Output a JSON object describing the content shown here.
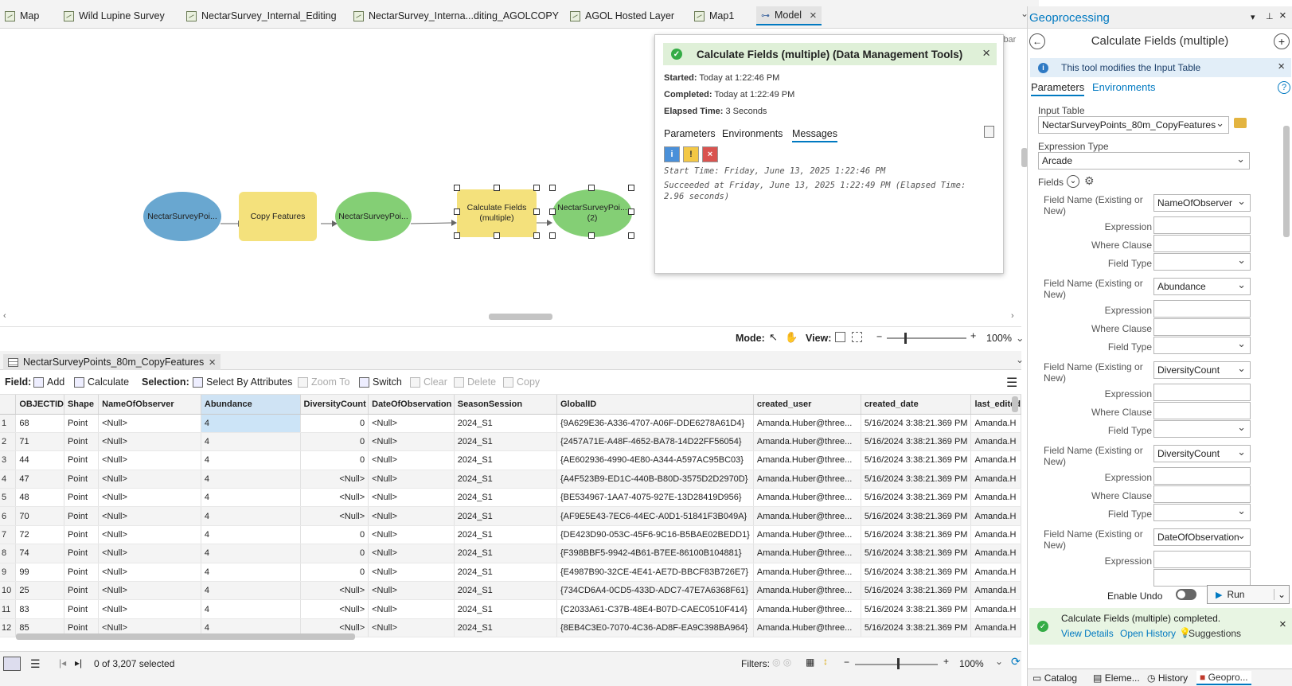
{
  "tabs": [
    {
      "label": "Map"
    },
    {
      "label": "Wild Lupine Survey"
    },
    {
      "label": "NectarSurvey_Internal_Editing"
    },
    {
      "label": "NectarSurvey_Interna...diting_AGOLCOPY"
    },
    {
      "label": "AGOL Hosted Layer"
    },
    {
      "label": "Map1"
    },
    {
      "label": "Model"
    }
  ],
  "model": {
    "nodes": [
      {
        "label": "NectarSurveyPoi...",
        "color": "#69a7d0"
      },
      {
        "label": "Copy Features",
        "color": "#f4e17c"
      },
      {
        "label": "NectarSurveyPoi...",
        "color": "#84cf75"
      },
      {
        "label": "Calculate Fields (multiple)",
        "color": "#f4e17c"
      },
      {
        "label": "NectarSurveyPoi... (2)",
        "color": "#84cf75"
      }
    ],
    "hidden_text": "lbar",
    "mode_label": "Mode:",
    "view_label": "View:",
    "zoom": "100%"
  },
  "popup": {
    "title": "Calculate Fields (multiple) (Data Management Tools)",
    "started_label": "Started:",
    "started_value": "Today at 1:22:46 PM",
    "completed_label": "Completed:",
    "completed_value": "Today at 1:22:49 PM",
    "elapsed_label": "Elapsed Time:",
    "elapsed_value": "3 Seconds",
    "tabs": [
      "Parameters",
      "Environments",
      "Messages"
    ],
    "msg1": "Start Time: Friday, June 13, 2025 1:22:46 PM",
    "msg2": "Succeeded at Friday, June 13, 2025 1:22:49 PM (Elapsed Time:",
    "msg3": "2.96 seconds)"
  },
  "table": {
    "tab_label": "NectarSurveyPoints_80m_CopyFeatures",
    "toolbar": {
      "field_label": "Field:",
      "add": "Add",
      "calculate": "Calculate",
      "selection_label": "Selection:",
      "select_by_attr": "Select By Attributes",
      "zoom_to": "Zoom To",
      "switch": "Switch",
      "clear": "Clear",
      "delete": "Delete",
      "copy": "Copy"
    },
    "columns": [
      "OBJECTID",
      "Shape",
      "NameOfObserver",
      "Abundance",
      "DiversityCount",
      "DateOfObservation",
      "SeasonSession",
      "GlobalID",
      "created_user",
      "created_date",
      "last_edited"
    ],
    "rows": [
      [
        "1",
        "68",
        "Point",
        "<Null>",
        "4",
        "0",
        "<Null>",
        "2024_S1",
        "{9A629E36-A336-4707-A06F-DDE6278A61D4}",
        "Amanda.Huber@three...",
        "5/16/2024 3:38:21.369 PM",
        "Amanda.H"
      ],
      [
        "2",
        "71",
        "Point",
        "<Null>",
        "4",
        "0",
        "<Null>",
        "2024_S1",
        "{2457A71E-A48F-4652-BA78-14D22FF56054}",
        "Amanda.Huber@three...",
        "5/16/2024 3:38:21.369 PM",
        "Amanda.H"
      ],
      [
        "3",
        "44",
        "Point",
        "<Null>",
        "4",
        "0",
        "<Null>",
        "2024_S1",
        "{AE602936-4990-4E80-A344-A597AC95BC03}",
        "Amanda.Huber@three...",
        "5/16/2024 3:38:21.369 PM",
        "Amanda.H"
      ],
      [
        "4",
        "47",
        "Point",
        "<Null>",
        "4",
        "<Null>",
        "<Null>",
        "2024_S1",
        "{A4F523B9-ED1C-440B-B80D-3575D2D2970D}",
        "Amanda.Huber@three...",
        "5/16/2024 3:38:21.369 PM",
        "Amanda.H"
      ],
      [
        "5",
        "48",
        "Point",
        "<Null>",
        "4",
        "<Null>",
        "<Null>",
        "2024_S1",
        "{BE534967-1AA7-4075-927E-13D28419D956}",
        "Amanda.Huber@three...",
        "5/16/2024 3:38:21.369 PM",
        "Amanda.H"
      ],
      [
        "6",
        "70",
        "Point",
        "<Null>",
        "4",
        "<Null>",
        "<Null>",
        "2024_S1",
        "{AF9E5E43-7EC6-44EC-A0D1-51841F3B049A}",
        "Amanda.Huber@three...",
        "5/16/2024 3:38:21.369 PM",
        "Amanda.H"
      ],
      [
        "7",
        "72",
        "Point",
        "<Null>",
        "4",
        "0",
        "<Null>",
        "2024_S1",
        "{DE423D90-053C-45F6-9C16-B5BAE02BEDD1}",
        "Amanda.Huber@three...",
        "5/16/2024 3:38:21.369 PM",
        "Amanda.H"
      ],
      [
        "8",
        "74",
        "Point",
        "<Null>",
        "4",
        "0",
        "<Null>",
        "2024_S1",
        "{F398BBF5-9942-4B61-B7EE-86100B104881}",
        "Amanda.Huber@three...",
        "5/16/2024 3:38:21.369 PM",
        "Amanda.H"
      ],
      [
        "9",
        "99",
        "Point",
        "<Null>",
        "4",
        "0",
        "<Null>",
        "2024_S1",
        "{E4987B90-32CE-4E41-AE7D-BBCF83B726E7}",
        "Amanda.Huber@three...",
        "5/16/2024 3:38:21.369 PM",
        "Amanda.H"
      ],
      [
        "10",
        "25",
        "Point",
        "<Null>",
        "4",
        "<Null>",
        "<Null>",
        "2024_S1",
        "{734CD6A4-0CD5-433D-ADC7-47E7A6368F61}",
        "Amanda.Huber@three...",
        "5/16/2024 3:38:21.369 PM",
        "Amanda.H"
      ],
      [
        "11",
        "83",
        "Point",
        "<Null>",
        "4",
        "<Null>",
        "<Null>",
        "2024_S1",
        "{C2033A61-C37B-48E4-B07D-CAEC0510F414}",
        "Amanda.Huber@three...",
        "5/16/2024 3:38:21.369 PM",
        "Amanda.H"
      ],
      [
        "12",
        "85",
        "Point",
        "<Null>",
        "4",
        "<Null>",
        "<Null>",
        "2024_S1",
        "{8EB4C3E0-7070-4C36-AD8F-EA9C398BA964}",
        "Amanda.Huber@three...",
        "5/16/2024 3:38:21.369 PM",
        "Amanda.H"
      ]
    ],
    "status_selected": "0 of 3,207 selected",
    "filters_label": "Filters:",
    "zoom": "100%"
  },
  "gp": {
    "pane_title": "Geoprocessing",
    "tool_title": "Calculate Fields (multiple)",
    "info": "This tool modifies the Input Table",
    "tab_parameters": "Parameters",
    "tab_environments": "Environments",
    "input_table_label": "Input Table",
    "input_table_value": "NectarSurveyPoints_80m_CopyFeatures",
    "expr_type_label": "Expression Type",
    "expr_type_value": "Arcade",
    "fields_label": "Fields",
    "field_name_label1": "Field Name (Existing or",
    "field_name_label2": "New)",
    "expression_label": "Expression",
    "where_label": "Where Clause",
    "field_type_label": "Field Type",
    "field_groups": [
      "NameOfObserver",
      "Abundance",
      "DiversityCount",
      "DiversityCount",
      "DateOfObservation"
    ],
    "enable_undo": "Enable Undo",
    "run": "Run",
    "completed_msg": "Calculate Fields (multiple) completed.",
    "view_details": "View Details",
    "open_history": "Open History",
    "suggestions": "Suggestions",
    "bottom_tabs": [
      "Catalog",
      "Eleme...",
      "History",
      "Geopro..."
    ]
  }
}
